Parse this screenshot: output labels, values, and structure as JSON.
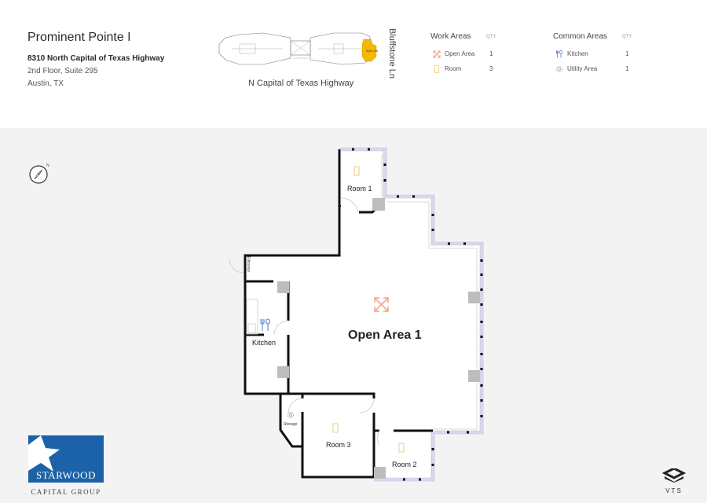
{
  "header": {
    "title": "Prominent Pointe I",
    "address_line1": "8310 North Capital of Texas Highway",
    "address_line2": "2nd Floor, Suite 295",
    "address_line3": "Austin, TX"
  },
  "keyplan": {
    "street_bottom": "N Capital of Texas Highway",
    "street_side": "Bluffstone Ln",
    "highlight_label": "Suite 295",
    "highlight_color": "#f5b800"
  },
  "legend": {
    "work_areas": {
      "heading": "Work Areas",
      "qty_label": "QTY",
      "items": [
        {
          "icon": "expand-arrows-icon",
          "label": "Open Area",
          "qty": "1"
        },
        {
          "icon": "door-icon",
          "label": "Room",
          "qty": "3"
        }
      ]
    },
    "common_areas": {
      "heading": "Common Areas",
      "qty_label": "QTY",
      "items": [
        {
          "icon": "utensils-icon",
          "label": "Kitchen",
          "qty": "1"
        },
        {
          "icon": "gear-icon",
          "label": "Utility Area",
          "qty": "1"
        }
      ]
    }
  },
  "compass": {
    "north_label": "N"
  },
  "floorplan": {
    "rooms": [
      {
        "name": "Room 1"
      },
      {
        "name": "Open Area 1"
      },
      {
        "name": "Kitchen"
      },
      {
        "name": "Room 3"
      },
      {
        "name": "Room 2"
      },
      {
        "name": "Storage"
      },
      {
        "name": "Entrance"
      }
    ]
  },
  "logos": {
    "starwood_line1": "STARWOOD",
    "starwood_line2": "CAPITAL GROUP",
    "vts": "VTS"
  },
  "colors": {
    "room_icon": "#f6c56b",
    "open_area_icon": "#f4a080",
    "kitchen_icon": "#4a7bd0",
    "column": "#bdbdbd",
    "window_frame": "#d8d8ee",
    "starwood_blue": "#1b62a8"
  }
}
